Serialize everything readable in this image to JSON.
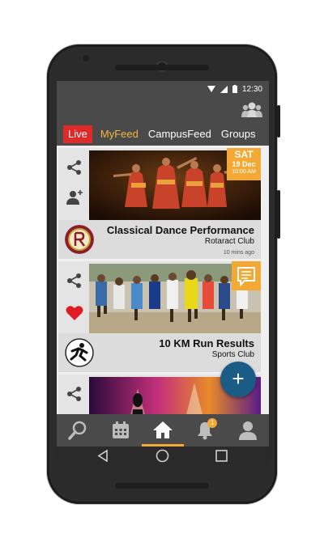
{
  "status_bar": {
    "time": "12:30"
  },
  "tabs": [
    "Live",
    "MyFeed",
    "CampusFeed",
    "Groups"
  ],
  "feed": [
    {
      "title": "Classical Dance Performance",
      "club": "Rotaract Club",
      "time_ago": "10 mins ago",
      "date_badge": {
        "day": "SAT",
        "date": "19 Dec",
        "time": "10:00 AM"
      }
    },
    {
      "title": "10 KM Run Results",
      "club": "Sports Club"
    }
  ],
  "notifications": {
    "count": "1"
  },
  "fab_label": "+",
  "colors": {
    "accent": "#f5a935",
    "live": "#e02a2a",
    "bar": "#4a4a4a",
    "fab": "#1a5c86",
    "heart": "#e01b24"
  }
}
